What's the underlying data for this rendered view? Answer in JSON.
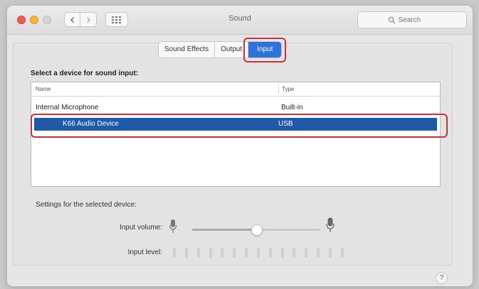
{
  "window": {
    "title": "Sound"
  },
  "toolbar": {
    "back_icon": "chevron-left-icon",
    "forward_icon": "chevron-right-icon",
    "grid_icon": "grid-icon",
    "search_placeholder": "Search",
    "search_icon": "search-icon"
  },
  "tabs": [
    {
      "label": "Sound Effects",
      "active": false
    },
    {
      "label": "Output",
      "active": false
    },
    {
      "label": "Input",
      "active": true
    }
  ],
  "input": {
    "heading": "Select a device for sound input:",
    "columns": [
      "Name",
      "Type"
    ],
    "devices": [
      {
        "name": "Internal Microphone",
        "type": "Built-in",
        "selected": false
      },
      {
        "name": "K66 Audio Device",
        "type": "USB",
        "selected": true
      }
    ]
  },
  "settings": {
    "heading": "Settings for the selected device:",
    "volume_label": "Input volume:",
    "volume_value": 0.5,
    "level_label": "Input level:",
    "level_segments": 15,
    "level_active": 0
  },
  "help": {
    "label": "?"
  },
  "colors": {
    "accent": "#2f73d8",
    "selection": "#1f5aa8",
    "annotation": "#c8313d"
  }
}
